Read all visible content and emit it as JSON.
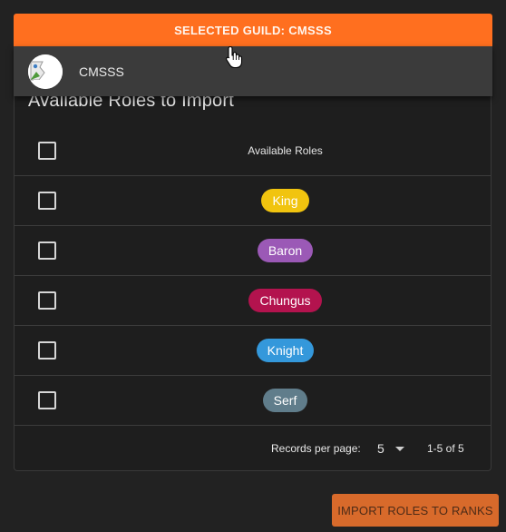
{
  "guild_selector": {
    "label": "SELECTED GUILD: CMSSS",
    "color": "#ff6f1f"
  },
  "guild_menu": {
    "items": [
      {
        "name": "CMSSS",
        "avatar": "broken-image-icon"
      }
    ]
  },
  "card": {
    "title": "Available Roles to Import"
  },
  "table": {
    "header": "Available Roles",
    "rows": [
      {
        "label": "King",
        "color": "#f1c40f"
      },
      {
        "label": "Baron",
        "color": "#9b59b6"
      },
      {
        "label": "Chungus",
        "color": "#b3134e"
      },
      {
        "label": "Knight",
        "color": "#3498db"
      },
      {
        "label": "Serf",
        "color": "#607d8b"
      }
    ]
  },
  "pagination": {
    "records_label": "Records per page:",
    "per_page": "5",
    "range": "1-5 of 5"
  },
  "actions": {
    "import_label": "IMPORT ROLES TO RANKS"
  }
}
